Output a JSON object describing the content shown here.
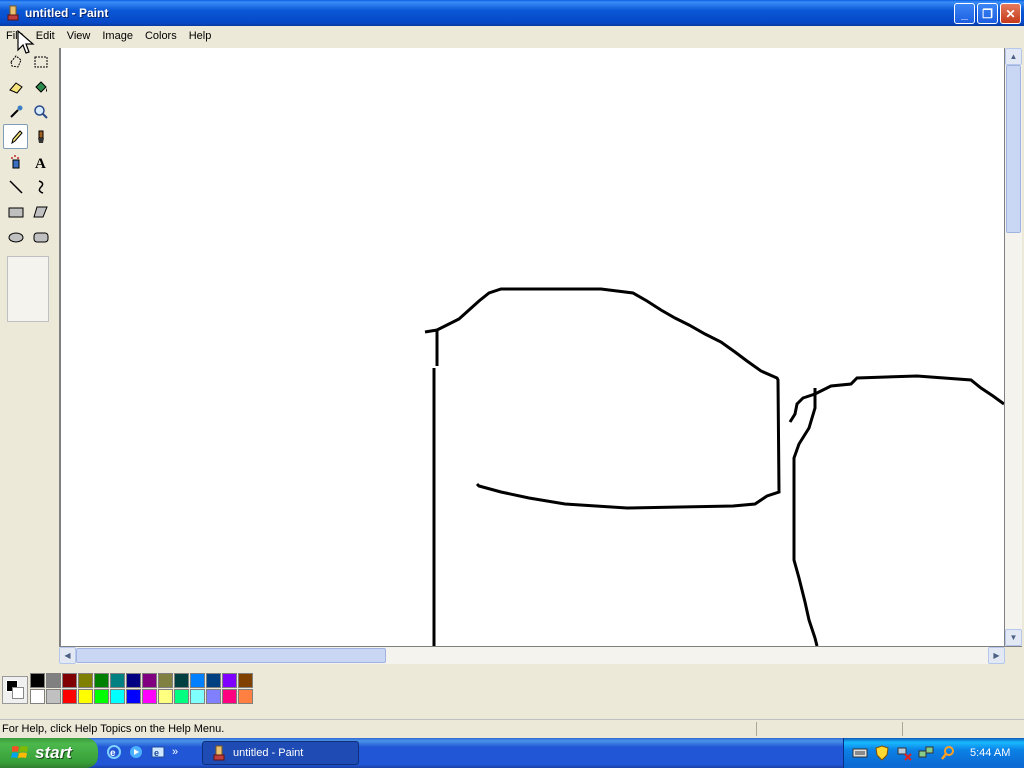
{
  "window": {
    "title": "untitled - Paint"
  },
  "menu": [
    "File",
    "Edit",
    "View",
    "Image",
    "Colors",
    "Help"
  ],
  "tools": [
    "free-select",
    "rect-select",
    "eraser",
    "fill",
    "color-picker",
    "magnifier",
    "pencil",
    "brush",
    "airbrush",
    "text",
    "line",
    "curve",
    "rectangle",
    "polygon",
    "ellipse",
    "rounded-rectangle"
  ],
  "active_tool": "pencil",
  "palette": {
    "top": [
      "#000000",
      "#808080",
      "#800000",
      "#808000",
      "#008000",
      "#008080",
      "#000080",
      "#800080",
      "#808040",
      "#004040",
      "#0080ff",
      "#004080",
      "#8000ff",
      "#804000"
    ],
    "bottom": [
      "#ffffff",
      "#c0c0c0",
      "#ff0000",
      "#ffff00",
      "#00ff00",
      "#00ffff",
      "#0000ff",
      "#ff00ff",
      "#ffff80",
      "#00ff80",
      "#80ffff",
      "#8080ff",
      "#ff0080",
      "#ff8040"
    ]
  },
  "status": {
    "help_text": "For Help, click Help Topics on the Help Menu."
  },
  "taskbar": {
    "start_label": "start",
    "task_label": "untitled - Paint",
    "clock": "5:44 AM"
  }
}
